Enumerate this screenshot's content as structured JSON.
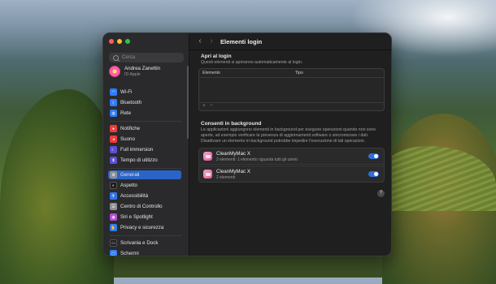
{
  "window": {
    "traffic_lights": [
      "#ff5f57",
      "#febc2e",
      "#28c840"
    ]
  },
  "sidebar": {
    "search_placeholder": "Cerca",
    "profile": {
      "name": "Andrea Zanettin",
      "subtitle": "ID Apple"
    },
    "items": [
      {
        "label": "Wi-Fi",
        "icon": "wifi-icon",
        "color": "#2f7cf6"
      },
      {
        "label": "Bluetooth",
        "icon": "bluetooth-icon",
        "color": "#2f7cf6"
      },
      {
        "label": "Rete",
        "icon": "network-icon",
        "color": "#2f7cf6"
      },
      {
        "label": "Notifiche",
        "icon": "bell-icon",
        "color": "#ef3b3b"
      },
      {
        "label": "Suono",
        "icon": "speaker-icon",
        "color": "#ef3b3b"
      },
      {
        "label": "Full immersion",
        "icon": "moon-icon",
        "color": "#5b4fd6"
      },
      {
        "label": "Tempo di utilizzo",
        "icon": "hourglass-icon",
        "color": "#5b4fd6"
      },
      {
        "label": "Generali",
        "icon": "gear-icon",
        "color": "#8e8e93",
        "selected": true
      },
      {
        "label": "Aspetto",
        "icon": "appearance-icon",
        "color": "#1c1c1e"
      },
      {
        "label": "Accessibilità",
        "icon": "accessibility-icon",
        "color": "#2f7cf6"
      },
      {
        "label": "Centro di Controllo",
        "icon": "control-center-icon",
        "color": "#8e8e93"
      },
      {
        "label": "Siri e Spotlight",
        "icon": "siri-icon",
        "color": "#b84ad8"
      },
      {
        "label": "Privacy e sicurezza",
        "icon": "hand-icon",
        "color": "#2f7cf6"
      },
      {
        "label": "Scrivania e Dock",
        "icon": "dock-icon",
        "color": "#1c1c1e"
      },
      {
        "label": "Schermi",
        "icon": "display-icon",
        "color": "#2f7cf6"
      }
    ]
  },
  "main": {
    "title": "Elementi login",
    "open_at_login": {
      "title": "Apri al login",
      "description": "Questi elementi si apriranno automaticamente al login.",
      "columns": [
        "Elemento",
        "Tipo"
      ],
      "add_label": "+",
      "remove_label": "−"
    },
    "background": {
      "title": "Consenti in background",
      "description": "Le applicazioni aggiungono elementi in background per eseguire operazioni quando non sono aperte, ad esempio verificare la presenza di aggiornamenti software o sincronizzare i dati. Disattivare un elemento in background potrebbe impedire l'esecuzione di tali operazioni.",
      "apps": [
        {
          "name": "CleanMyMac X",
          "detail": "2 elementi: 1 elemento riguarda tutti gli utenti",
          "enabled": true
        },
        {
          "name": "CleanMyMac X",
          "detail": "2 elementi",
          "enabled": true
        }
      ]
    },
    "help_label": "?"
  }
}
